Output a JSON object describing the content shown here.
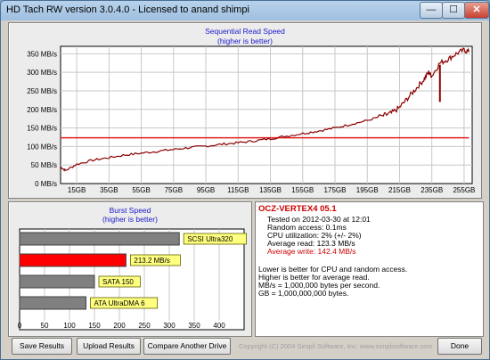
{
  "window": {
    "title": "HD Tach RW version 3.0.4.0 - Licensed to anand shimpi",
    "minimize_glyph": "—",
    "maximize_glyph": "☐",
    "close_glyph": "✕"
  },
  "read_chart": {
    "title": "Sequential Read Speed",
    "subtitle": "(higher is better)",
    "y_ticks": [
      "350 MB/s",
      "300 MB/s",
      "250 MB/s",
      "200 MB/s",
      "150 MB/s",
      "100 MB/s",
      "50 MB/s",
      "0 MB/s"
    ],
    "x_ticks": [
      "15GB",
      "35GB",
      "55GB",
      "75GB",
      "95GB",
      "115GB",
      "135GB",
      "155GB",
      "175GB",
      "195GB",
      "215GB",
      "235GB",
      "255GB"
    ]
  },
  "burst_chart": {
    "title": "Burst Speed",
    "subtitle": "(higher is better)",
    "x_ticks": [
      "0",
      "50",
      "100",
      "150",
      "200",
      "250",
      "300",
      "350",
      "400"
    ],
    "bars": [
      {
        "label": "SCSI Ultra320",
        "value": 320,
        "color": "#808080"
      },
      {
        "label": "213.2 MB/s",
        "value": 213.2,
        "color": "#ff0000"
      },
      {
        "label": "SATA 150",
        "value": 150,
        "color": "#808080"
      },
      {
        "label": "ATA UltraDMA 6",
        "value": 133,
        "color": "#808080"
      }
    ]
  },
  "info": {
    "drive": "OCZ-VERTEX4 05.1",
    "tested": "Tested on 2012-03-30 at 12:01",
    "random_access": "Random access: 0.1ms",
    "cpu": "CPU utilization: 2% (+/- 2%)",
    "avg_read": "Average read: 123.3 MB/s",
    "avg_write": "Average write: 142.4 MB/s",
    "note1": "Lower is better for CPU and random access.",
    "note2": "Higher is better for average read.",
    "note3": "MB/s = 1,000,000 bytes per second.",
    "note4": "GB = 1,000,000,000 bytes."
  },
  "buttons": {
    "save": "Save Results",
    "upload": "Upload Results",
    "compare": "Compare Another Drive",
    "done": "Done"
  },
  "copyright": "Copyright (C) 2004 Simpli Software, Inc. www.simplisoftware.com",
  "chart_data": [
    {
      "type": "line",
      "title": "Sequential Read Speed",
      "subtitle": "(higher is better)",
      "xlabel": "",
      "ylabel": "",
      "xlim": [
        5,
        260
      ],
      "ylim": [
        0,
        370
      ],
      "series": [
        {
          "values_x": [
            5,
            8,
            15,
            25,
            35,
            45,
            55,
            65,
            75,
            85,
            95,
            105,
            115,
            125,
            135,
            145,
            155,
            165,
            175,
            185,
            195,
            205,
            210,
            215,
            220,
            225,
            230,
            233,
            235,
            240,
            245,
            250,
            255,
            258
          ],
          "values": [
            45,
            35,
            52,
            63,
            70,
            77,
            82,
            87,
            92,
            97,
            101,
            106,
            110,
            115,
            121,
            128,
            135,
            142,
            150,
            160,
            170,
            183,
            190,
            205,
            230,
            255,
            280,
            300,
            290,
            325,
            335,
            350,
            360,
            355
          ],
          "color": "#8b0000"
        },
        {
          "values_x": [
            5,
            258
          ],
          "values": [
            123.3,
            123.3
          ],
          "color": "#e02020"
        }
      ]
    },
    {
      "type": "bar",
      "title": "Burst Speed",
      "subtitle": "(higher is better)",
      "categories": [
        "SCSI Ultra320",
        "213.2 MB/s",
        "SATA 150",
        "ATA UltraDMA 6"
      ],
      "values": [
        320,
        213.2,
        150,
        133
      ],
      "xlim": [
        0,
        450
      ]
    }
  ]
}
